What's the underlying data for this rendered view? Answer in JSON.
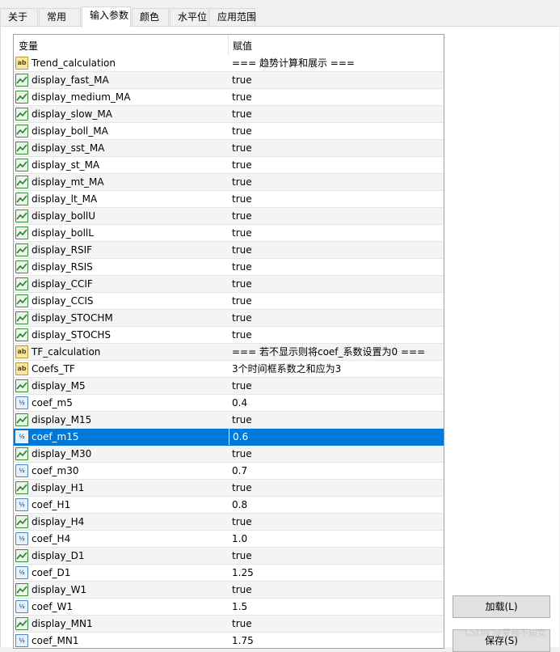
{
  "tabs": [
    {
      "label": "关于",
      "active": false
    },
    {
      "label": "常用",
      "active": false
    },
    {
      "label": "输入参数",
      "active": true
    },
    {
      "label": "颜色",
      "active": false
    },
    {
      "label": "水平位",
      "active": false
    },
    {
      "label": "应用范围",
      "active": false
    }
  ],
  "grid": {
    "col_variable": "变量",
    "col_value": "赋值",
    "rows": [
      {
        "icon": "string-icon",
        "name": "Trend_calculation",
        "value": "=== 趋势计算和展示 ==="
      },
      {
        "icon": "bool-icon",
        "name": "display_fast_MA",
        "value": "true"
      },
      {
        "icon": "bool-icon",
        "name": "display_medium_MA",
        "value": "true"
      },
      {
        "icon": "bool-icon",
        "name": "display_slow_MA",
        "value": "true"
      },
      {
        "icon": "bool-icon",
        "name": "display_boll_MA",
        "value": "true"
      },
      {
        "icon": "bool-icon",
        "name": "display_sst_MA",
        "value": "true"
      },
      {
        "icon": "bool-icon",
        "name": "display_st_MA",
        "value": "true"
      },
      {
        "icon": "bool-icon",
        "name": "display_mt_MA",
        "value": "true"
      },
      {
        "icon": "bool-icon",
        "name": "display_lt_MA",
        "value": "true"
      },
      {
        "icon": "bool-icon",
        "name": "display_bollU",
        "value": "true"
      },
      {
        "icon": "bool-icon",
        "name": "display_bollL",
        "value": "true"
      },
      {
        "icon": "bool-icon",
        "name": "display_RSIF",
        "value": "true"
      },
      {
        "icon": "bool-icon",
        "name": "display_RSIS",
        "value": "true"
      },
      {
        "icon": "bool-icon",
        "name": "display_CCIF",
        "value": "true"
      },
      {
        "icon": "bool-icon",
        "name": "display_CCIS",
        "value": "true"
      },
      {
        "icon": "bool-icon",
        "name": "display_STOCHM",
        "value": "true"
      },
      {
        "icon": "bool-icon",
        "name": "display_STOCHS",
        "value": "true"
      },
      {
        "icon": "string-icon",
        "name": "TF_calculation",
        "value": "=== 若不显示则将coef_系数设置为0 ==="
      },
      {
        "icon": "string-icon",
        "name": "Coefs_TF",
        "value": "3个时间框系数之和应为3"
      },
      {
        "icon": "bool-icon",
        "name": "display_M5",
        "value": "true"
      },
      {
        "icon": "double-icon",
        "name": "coef_m5",
        "value": "0.4"
      },
      {
        "icon": "bool-icon",
        "name": "display_M15",
        "value": "true"
      },
      {
        "icon": "double-icon",
        "name": "coef_m15",
        "value": "0.6",
        "selected": true
      },
      {
        "icon": "bool-icon",
        "name": "display_M30",
        "value": "true"
      },
      {
        "icon": "double-icon",
        "name": "coef_m30",
        "value": "0.7"
      },
      {
        "icon": "bool-icon",
        "name": "display_H1",
        "value": "true"
      },
      {
        "icon": "double-icon",
        "name": "coef_H1",
        "value": "0.8"
      },
      {
        "icon": "bool-icon",
        "name": "display_H4",
        "value": "true"
      },
      {
        "icon": "double-icon",
        "name": "coef_H4",
        "value": "1.0"
      },
      {
        "icon": "bool-icon",
        "name": "display_D1",
        "value": "true"
      },
      {
        "icon": "double-icon",
        "name": "coef_D1",
        "value": "1.25"
      },
      {
        "icon": "bool-icon",
        "name": "display_W1",
        "value": "true"
      },
      {
        "icon": "double-icon",
        "name": "coef_W1",
        "value": "1.5"
      },
      {
        "icon": "bool-icon",
        "name": "display_MN1",
        "value": "true"
      },
      {
        "icon": "double-icon",
        "name": "coef_MN1",
        "value": "1.75"
      }
    ]
  },
  "buttons": {
    "load_label": "加载(L)",
    "save_label": "保存(S)"
  },
  "watermark": "CSDN @爱茜不知女",
  "colors": {
    "selection": "#0078d7",
    "alt_row": "#f4f4f4"
  }
}
